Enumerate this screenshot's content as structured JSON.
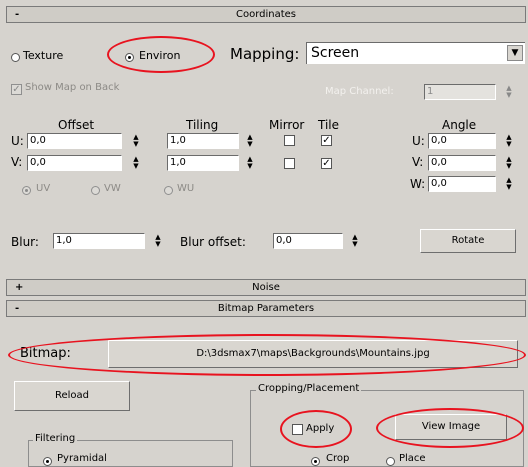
{
  "coordinates": {
    "title": "Coordinates",
    "collapse_sign": "-",
    "texture_label": "Texture",
    "environ_label": "Environ",
    "mapping_label": "Mapping:",
    "mapping_value": "Screen",
    "show_map_on_back": "Show Map on Back",
    "map_channel_label": "Map Channel:",
    "map_channel_value": "1",
    "offset_label": "Offset",
    "tiling_label": "Tiling",
    "mirror_label": "Mirror",
    "tile_label": "Tile",
    "angle_label": "Angle",
    "u_label": "U:",
    "v_label": "V:",
    "w_label": "W:",
    "offset_u": "0,0",
    "offset_v": "0,0",
    "tiling_u": "1,0",
    "tiling_v": "1,0",
    "angle_u": "0,0",
    "angle_v": "0,0",
    "angle_w": "0,0",
    "uv_label": "UV",
    "vw_label": "VW",
    "wu_label": "WU",
    "blur_label": "Blur:",
    "blur_value": "1,0",
    "blur_offset_label": "Blur offset:",
    "blur_offset_value": "0,0",
    "rotate_label": "Rotate"
  },
  "noise": {
    "title": "Noise",
    "expand_sign": "+"
  },
  "bitmap_params": {
    "title": "Bitmap Parameters",
    "collapse_sign": "-",
    "bitmap_label": "Bitmap:",
    "bitmap_path": "D:\\3dsmax7\\maps\\Backgrounds\\Mountains.jpg",
    "reload_label": "Reload",
    "cropping_label": "Cropping/Placement",
    "apply_label": "Apply",
    "view_image_label": "View Image",
    "filtering_label": "Filtering",
    "pyramidal_label": "Pyramidal",
    "crop_label": "Crop",
    "place_label": "Place"
  },
  "colors": {
    "highlight_oval": "#e8131f",
    "panel_bg": "#d6d3ce"
  }
}
